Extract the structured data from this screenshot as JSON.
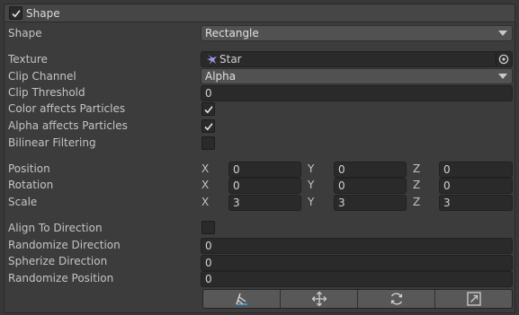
{
  "header": {
    "title": "Shape",
    "enabled": true
  },
  "shape": {
    "label": "Shape",
    "value": "Rectangle"
  },
  "texture": {
    "label": "Texture",
    "value": "Star"
  },
  "clip_channel": {
    "label": "Clip Channel",
    "value": "Alpha"
  },
  "clip_threshold": {
    "label": "Clip Threshold",
    "value": "0"
  },
  "color_affects": {
    "label": "Color affects Particles",
    "checked": true
  },
  "alpha_affects": {
    "label": "Alpha affects Particles",
    "checked": true
  },
  "bilinear": {
    "label": "Bilinear Filtering",
    "checked": false
  },
  "position": {
    "label": "Position",
    "x": "0",
    "y": "0",
    "z": "0"
  },
  "rotation": {
    "label": "Rotation",
    "x": "0",
    "y": "0",
    "z": "0"
  },
  "scale": {
    "label": "Scale",
    "x": "3",
    "y": "3",
    "z": "3"
  },
  "axes": {
    "x": "X",
    "y": "Y",
    "z": "Z"
  },
  "align_to_direction": {
    "label": "Align To Direction",
    "checked": false
  },
  "randomize_direction": {
    "label": "Randomize Direction",
    "value": "0"
  },
  "spherize_direction": {
    "label": "Spherize Direction",
    "value": "0"
  },
  "randomize_position": {
    "label": "Randomize Position",
    "value": "0"
  },
  "toolbar": {
    "icons": [
      "edit-shape-icon",
      "move-icon",
      "rotate-icon",
      "scale-icon"
    ]
  }
}
